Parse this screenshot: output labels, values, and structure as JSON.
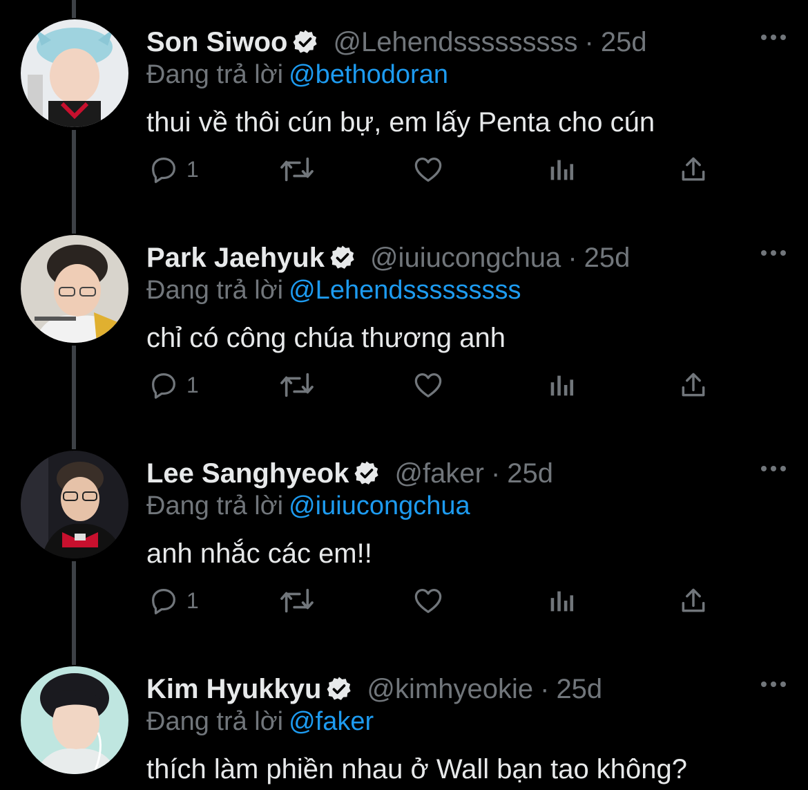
{
  "colors": {
    "background": "#000000",
    "text_primary": "#e7e9ea",
    "text_secondary": "#71767b",
    "accent_link": "#1d9bf0",
    "thread_line": "#3d4146"
  },
  "reply_prefix": "Đang trả lời",
  "tweets": [
    {
      "name": "Son Siwoo",
      "handle": "@Lehendsssssssss",
      "dot": "·",
      "time": "25d",
      "reply_to": "@bethodoran",
      "text": "thui về thôi cún bự, em lấy Penta cho cún",
      "reply_count": "1",
      "avatar_icon": "avatar-son-siwoo",
      "verified_icon": "verified-badge-icon"
    },
    {
      "name": "Park Jaehyuk",
      "handle": "@iuiucongchua",
      "dot": "·",
      "time": "25d",
      "reply_to": "@Lehendsssssssss",
      "text": "chỉ có công chúa thương anh",
      "reply_count": "1",
      "avatar_icon": "avatar-park-jaehyuk",
      "verified_icon": "verified-badge-icon"
    },
    {
      "name": "Lee Sanghyeok",
      "handle": "@faker",
      "dot": "·",
      "time": "25d",
      "reply_to": "@iuiucongchua",
      "text": "anh nhắc các em!!",
      "reply_count": "1",
      "avatar_icon": "avatar-lee-sanghyeok",
      "verified_icon": "verified-badge-icon"
    },
    {
      "name": "Kim Hyukkyu",
      "handle": "@kimhyeokie",
      "dot": "·",
      "time": "25d",
      "reply_to": "@faker",
      "text": "thích làm phiền nhau ở Wall bạn tao không?",
      "avatar_icon": "avatar-kim-hyukkyu",
      "verified_icon": "verified-badge-icon"
    }
  ],
  "action_icons": [
    "reply-icon",
    "retweet-icon",
    "like-icon",
    "views-icon",
    "share-icon"
  ]
}
